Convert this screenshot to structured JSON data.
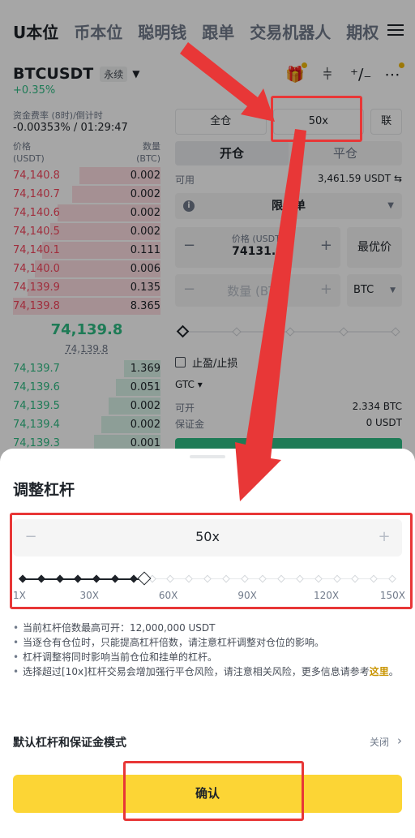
{
  "top_tabs": [
    {
      "label": "U本位",
      "active": true
    },
    {
      "label": "币本位",
      "active": false
    },
    {
      "label": "聪明钱",
      "active": false
    },
    {
      "label": "跟单",
      "active": false
    },
    {
      "label": "交易机器人",
      "active": false
    },
    {
      "label": "期权",
      "active": false
    }
  ],
  "pair": {
    "symbol": "BTCUSDT",
    "tag": "永续",
    "change": "+0.35%"
  },
  "funding": {
    "label": "资金费率 (8时)/倒计时",
    "value": "-0.00353% / 01:29:47"
  },
  "orderbook": {
    "price_header": "价格",
    "price_unit": "(USDT)",
    "qty_header": "数量",
    "qty_unit": "(BTC)",
    "asks": [
      {
        "price": "74,140.8",
        "qty": "0.002",
        "depth": 0.55
      },
      {
        "price": "74,140.7",
        "qty": "0.002",
        "depth": 0.6
      },
      {
        "price": "74,140.6",
        "qty": "0.002",
        "depth": 0.7
      },
      {
        "price": "74,140.5",
        "qty": "0.002",
        "depth": 0.75
      },
      {
        "price": "74,140.1",
        "qty": "0.111",
        "depth": 0.8
      },
      {
        "price": "74,140.0",
        "qty": "0.006",
        "depth": 0.85
      },
      {
        "price": "74,139.9",
        "qty": "0.135",
        "depth": 0.9
      },
      {
        "price": "74,139.8",
        "qty": "8.365",
        "depth": 1.0
      }
    ],
    "mid_price": "74,139.8",
    "mark_price": "74,139.8",
    "bids": [
      {
        "price": "74,139.7",
        "qty": "1.369",
        "depth": 0.25
      },
      {
        "price": "74,139.6",
        "qty": "0.051",
        "depth": 0.3
      },
      {
        "price": "74,139.5",
        "qty": "0.002",
        "depth": 0.35
      },
      {
        "price": "74,139.4",
        "qty": "0.002",
        "depth": 0.4
      },
      {
        "price": "74,139.3",
        "qty": "0.001",
        "depth": 0.45
      }
    ]
  },
  "order_panel": {
    "margin_mode": "全仓",
    "leverage": "50x",
    "asset_mode": "联",
    "open_tab": "开仓",
    "close_tab": "平仓",
    "available_label": "可用",
    "available_value": "3,461.59 USDT ⇆",
    "order_type": "限价单",
    "price_label": "价格 (USDT)",
    "price_value": "74131.9",
    "best_price": "最优价",
    "qty_placeholder": "数量 (BTC)",
    "qty_unit": "BTC",
    "tpsl": "止盈/止损",
    "tif": "GTC ▾",
    "can_open_label": "可开",
    "can_open_value": "2.334 BTC",
    "margin_label": "保证金",
    "margin_value": "0 USDT"
  },
  "sheet": {
    "title": "调整杠杆",
    "stepper_minus": "−",
    "stepper_plus": "+",
    "leverage_value": "50x",
    "slider": {
      "min": 1,
      "max": 150,
      "current": 50,
      "marks": [
        1,
        30,
        60,
        90,
        120,
        150
      ],
      "steps": 20
    },
    "slider_labels": [
      "1X",
      "30X",
      "60X",
      "90X",
      "120X",
      "150X"
    ],
    "notes": [
      "当前杠杆倍数最高可开：12,000,000 USDT",
      "当逐仓有仓位时，只能提高杠杆倍数，请注意杠杆调整对仓位的影响。",
      "杠杆调整将同时影响当前仓位和挂单的杠杆。",
      "选择超过[10x]杠杆交易会增加强行平仓风险，请注意相关风险，更多信息请参考"
    ],
    "notes_link": "这里",
    "notes_suffix": "。",
    "default_label": "默认杠杆和保证金模式",
    "default_value": "关闭",
    "confirm_label": "确认"
  },
  "colors": {
    "accent": "#fcd535",
    "annotation": "#e83737",
    "ask": "#f6465d",
    "bid": "#2ebd85"
  }
}
